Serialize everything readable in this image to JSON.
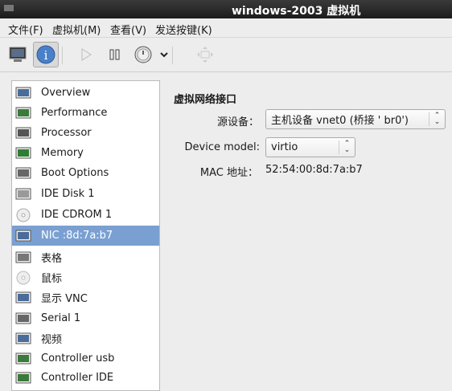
{
  "window": {
    "title": "windows-2003 虚拟机"
  },
  "menu": [
    "文件(F)",
    "虚拟机(M)",
    "查看(V)",
    "发送按键(K)"
  ],
  "toolbar": {
    "buttons": [
      "console-icon",
      "details-icon",
      "run-icon",
      "pause-icon",
      "power-icon",
      "dropdown-icon",
      "fullscreen-icon"
    ]
  },
  "sidebar": {
    "items": [
      {
        "label": "Overview",
        "icon": "monitor-icon"
      },
      {
        "label": "Performance",
        "icon": "performance-icon"
      },
      {
        "label": "Processor",
        "icon": "cpu-icon"
      },
      {
        "label": "Memory",
        "icon": "memory-icon"
      },
      {
        "label": "Boot Options",
        "icon": "gear-icon"
      },
      {
        "label": "IDE Disk 1",
        "icon": "disk-icon"
      },
      {
        "label": "IDE CDROM 1",
        "icon": "cdrom-icon"
      },
      {
        "label": "NIC :8d:7a:b7",
        "icon": "network-icon",
        "selected": true
      },
      {
        "label": "表格",
        "icon": "tablet-icon"
      },
      {
        "label": "鼠标",
        "icon": "mouse-icon"
      },
      {
        "label": "显示 VNC",
        "icon": "display-icon"
      },
      {
        "label": "Serial 1",
        "icon": "serial-icon"
      },
      {
        "label": "视频",
        "icon": "video-icon"
      },
      {
        "label": "Controller usb",
        "icon": "controller-icon"
      },
      {
        "label": "Controller IDE",
        "icon": "controller-icon"
      }
    ]
  },
  "details": {
    "heading": "虚拟网络接口",
    "source_label": "源设备：",
    "source_value": "主机设备 vnet0 (桥接 ' br0')",
    "model_label": "Device model:",
    "model_value": "virtio",
    "mac_label": "MAC 地址：",
    "mac_value": "52:54:00:8d:7a:b7"
  },
  "colors": {
    "selection": "#7aa0d2",
    "titlebar": "#2a2a2a"
  }
}
